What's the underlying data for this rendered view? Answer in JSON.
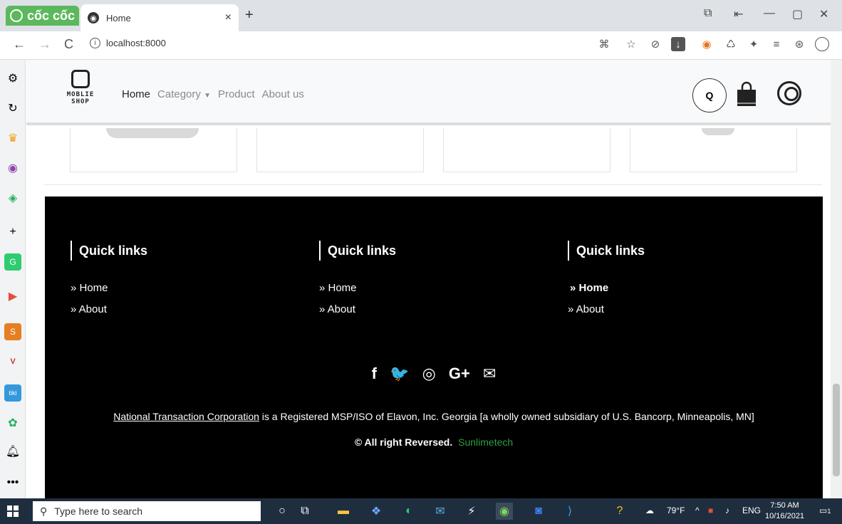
{
  "browser": {
    "brand": "cốc cốc",
    "tab_title": "Home",
    "tab_close": "×",
    "new_tab": "+",
    "url": "localhost:8000",
    "win_min": "—",
    "win_max": "▢",
    "win_close": "✕",
    "back": "←",
    "forward": "→",
    "reload": "C",
    "info": "i"
  },
  "site": {
    "logo_line1": "MOBLIE",
    "logo_line2": "SHOP",
    "nav": {
      "home": "Home",
      "category": "Category",
      "product": "Product",
      "about": "About us"
    },
    "search_label": "Q"
  },
  "footer": {
    "columns": [
      {
        "title": "Quick links",
        "links": [
          "» Home",
          "» About"
        ]
      },
      {
        "title": "Quick links",
        "links": [
          "» Home",
          "» About"
        ]
      },
      {
        "title": "Quick links",
        "links": [
          "» Home",
          "» About"
        ]
      }
    ],
    "social": [
      "f",
      "🐦",
      "◎",
      "G+",
      "✉"
    ],
    "legal_link": "National Transaction Corporation",
    "legal_text": " is a Registered MSP/ISO of Elavon, Inc. Georgia [a wholly owned subsidiary of U.S. Bancorp, Minneapolis, MN]",
    "copyright": "© All right Reversed.",
    "company": "Sunlimetech",
    "accent_color": "#2e9e3e"
  },
  "taskbar": {
    "search_placeholder": "Type here to search",
    "weather": "79°F",
    "lang": "ENG",
    "time": "7:50 AM",
    "date": "10/16/2021",
    "notifications": "1"
  }
}
